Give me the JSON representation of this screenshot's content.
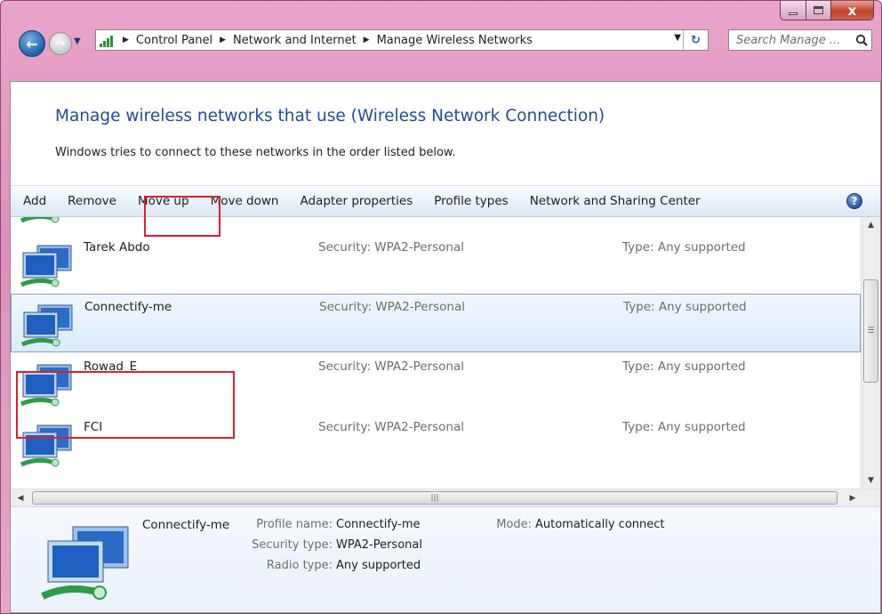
{
  "window": {
    "caption_buttons": {
      "minimize_icon": "minimize-icon",
      "maximize_icon": "maximize-icon",
      "close_label": "x"
    }
  },
  "nav": {
    "back_glyph": "←",
    "forward_glyph": "→",
    "breadcrumbs": [
      "Control Panel",
      "Network and Internet",
      "Manage Wireless Networks"
    ],
    "search_placeholder": "Search Manage ..."
  },
  "main": {
    "heading": "Manage wireless networks that use (Wireless Network Connection)",
    "subtext": "Windows tries to connect to these networks in the order listed below."
  },
  "toolbar": {
    "items": [
      "Add",
      "Remove",
      "Move up",
      "Move down",
      "Adapter properties",
      "Profile types",
      "Network and Sharing Center"
    ],
    "help_glyph": "?"
  },
  "networks": [
    {
      "name": "",
      "security": "",
      "type": ""
    },
    {
      "name": "Tarek Abdo",
      "security": "Security: WPA2-Personal",
      "type": "Type: Any supported"
    },
    {
      "name": "Connectify-me",
      "security": "Security: WPA2-Personal",
      "type": "Type: Any supported",
      "selected": true
    },
    {
      "name": "Rowad_E",
      "security": "Security: WPA2-Personal",
      "type": "Type: Any supported"
    },
    {
      "name": "FCI",
      "security": "Security: WPA2-Personal",
      "type": "Type: Any supported"
    }
  ],
  "details": {
    "name": "Connectify-me",
    "profile_name_label": "Profile name:",
    "profile_name": "Connectify-me",
    "security_type_label": "Security type:",
    "security_type": "WPA2-Personal",
    "radio_type_label": "Radio type:",
    "radio_type": "Any supported",
    "mode_label": "Mode:",
    "mode": "Automatically connect"
  },
  "colors": {
    "accent_heading": "#1e4b9b",
    "highlight_box": "#d7202f",
    "selection": "#dbeafa",
    "frame": "#df8fbd"
  }
}
